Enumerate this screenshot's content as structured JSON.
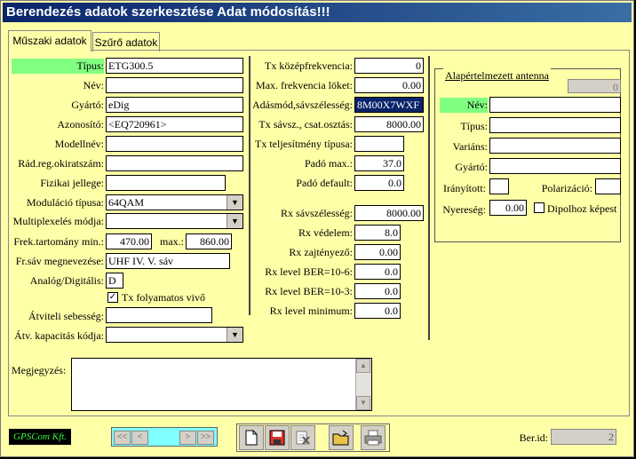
{
  "title": "Berendezés adatok szerkesztése   Adat módosítás!!!",
  "tabs": [
    "Műszaki adatok",
    "Szűrő adatok"
  ],
  "left": {
    "tipus_label": "Típus:",
    "tipus_value": "ETG300.5",
    "nev_label": "Név:",
    "nev_value": "",
    "gyarto_label": "Gyártó:",
    "gyarto_value": "eDig",
    "azonosito_label": "Azonosító:",
    "azonosito_value": "<EQ720961>",
    "modellnev_label": "Modellnév:",
    "modellnev_value": "",
    "radreg_label": "Rád.reg.okiratszám:",
    "radreg_value": "",
    "fizikai_label": "Fizikai jellege:",
    "fizikai_value": "",
    "modulacio_label": "Moduláció típusa:",
    "modulacio_value": "64QAM",
    "multiplex_label": "Multiplexelés módja:",
    "multiplex_value": "",
    "frek_label": "Frek.tartomány min.:",
    "frek_min": "470.00",
    "max_label": "max.:",
    "frek_max": "860.00",
    "frsav_label": "Fr.sáv megnevezése:",
    "frsav_value": "UHF IV. V. sáv",
    "analog_label": "Analóg/Digitális:",
    "analog_value": "D",
    "txfoly_label": "Tx folyamatos vivő",
    "atviteli_label": "Átviteli sebesség:",
    "atviteli_value": "",
    "atvkap_label": "Átv. kapacitás kódja:",
    "atvkap_value": ""
  },
  "middle": {
    "txkozep_label": "Tx középfrekvencia:",
    "txkozep_value": "0",
    "maxfrek_label": "Max. frekvencia löket:",
    "maxfrek_value": "0.00",
    "adasmod_label": "Adásmód,sávszélesség:",
    "adasmod_value": "8M00X7WXF",
    "txsavsz_label": "Tx sávsz., csat.osztás:",
    "txsavsz_value": "8000.00",
    "txtelj_label": "Tx teljesítmény típusa:",
    "txtelj_value": "",
    "pado_max_label": "Padó max.:",
    "pado_max_value": "37.0",
    "pado_def_label": "Padó default:",
    "pado_def_value": "0.0",
    "rxsav_label": "Rx sávszélesség:",
    "rxsav_value": "8000.00",
    "rxved_label": "Rx védelem:",
    "rxved_value": "8.0",
    "rxzaj_label": "Rx zajtényező:",
    "rxzaj_value": "0.00",
    "rxber6_label": "Rx level BER=10-6:",
    "rxber6_value": "0.0",
    "rxber3_label": "Rx level BER=10-3:",
    "rxber3_value": "0.0",
    "rxmin_label": "Rx level minimum:",
    "rxmin_value": "0.0"
  },
  "antenna": {
    "group_title": "Alapértelmezett antenna",
    "id_value": "0",
    "nev_label": "Név:",
    "tipus_label": "Típus:",
    "varians_label": "Variáns:",
    "gyarto_label": "Gyártó:",
    "iranyitott_label": "Irányított:",
    "polarizacio_label": "Polarizáció:",
    "nyereseg_label": "Nyereség:",
    "nyereseg_value": "0.00",
    "dipol_label": "Dipolhoz képest"
  },
  "megjegyzes_label": "Megjegyzés:",
  "footer": {
    "brand": "GPSCom Kft.",
    "nav": [
      "<<",
      "<",
      ">",
      ">>"
    ],
    "berid_label": "Ber.id:",
    "berid_value": "2"
  },
  "colors": {
    "background": "#ffffa8",
    "highlight": "#80ff80",
    "titlebar": "#0a246a",
    "nav_bg": "#80ffff"
  }
}
